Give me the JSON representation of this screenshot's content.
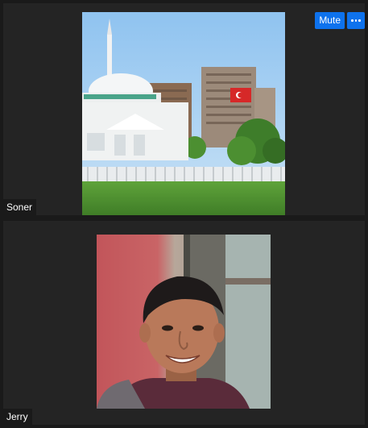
{
  "participants": [
    {
      "name": "Soner",
      "video_content": "mosque-and-apartment-buildings-scene"
    },
    {
      "name": "Jerry",
      "video_content": "smiling-man-portrait"
    }
  ],
  "controls": {
    "mute_label": "Mute",
    "more_icon": "ellipsis-icon"
  },
  "colors": {
    "background": "#1a1a1a",
    "tile": "#242424",
    "button": "#0e72ed"
  }
}
